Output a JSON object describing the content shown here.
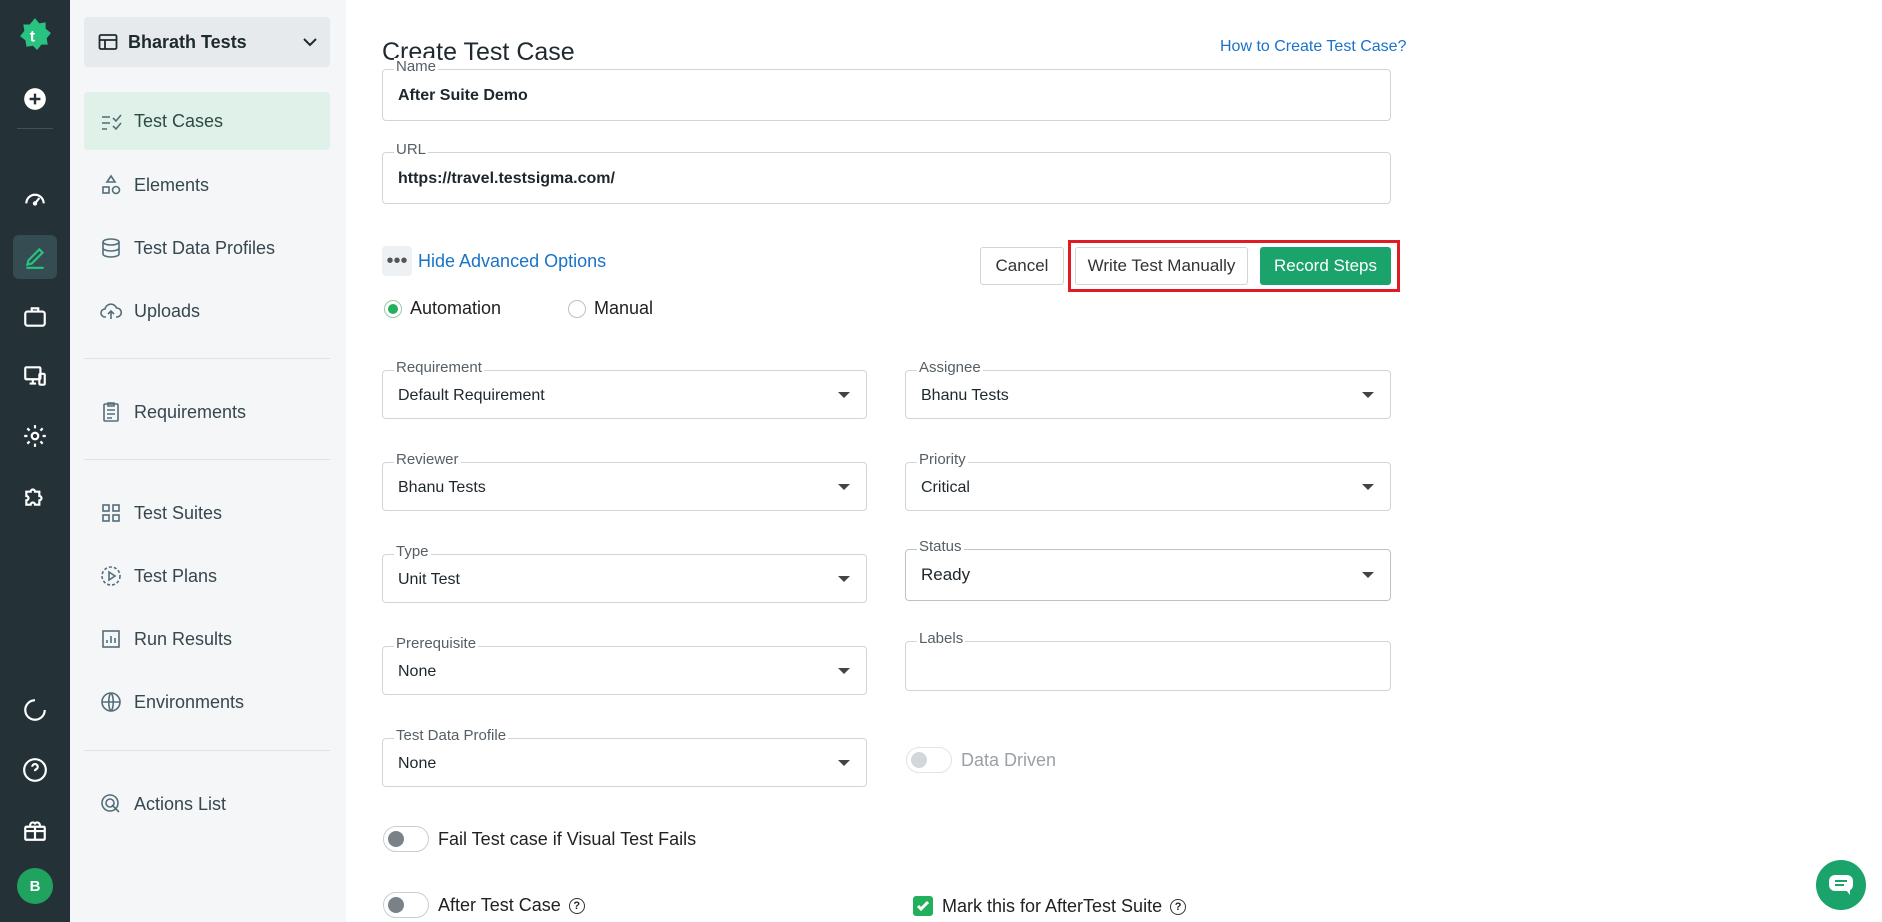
{
  "workspace": {
    "name": "Bharath Tests"
  },
  "sidebar": {
    "items": [
      {
        "label": "Test Cases",
        "icon": "checklist-icon"
      },
      {
        "label": "Elements",
        "icon": "shapes-icon"
      },
      {
        "label": "Test Data Profiles",
        "icon": "database-icon"
      },
      {
        "label": "Uploads",
        "icon": "cloud-upload-icon"
      },
      {
        "label": "Requirements",
        "icon": "clipboard-icon"
      },
      {
        "label": "Test Suites",
        "icon": "grid-icon"
      },
      {
        "label": "Test Plans",
        "icon": "play-circle-icon"
      },
      {
        "label": "Run Results",
        "icon": "bar-chart-icon"
      },
      {
        "label": "Environments",
        "icon": "globe-icon"
      },
      {
        "label": "Actions List",
        "icon": "target-icon"
      }
    ]
  },
  "rail": {
    "avatar_initial": "B"
  },
  "page": {
    "title": "Create Test Case",
    "help_link": "How to Create Test Case?"
  },
  "form": {
    "name": {
      "label": "Name",
      "value": "After Suite Demo"
    },
    "url": {
      "label": "URL",
      "value": "https://travel.testsigma.com/"
    },
    "advanced_toggle": "Hide Advanced Options",
    "buttons": {
      "cancel": "Cancel",
      "write": "Write Test Manually",
      "record": "Record Steps"
    },
    "mode": {
      "automation": "Automation",
      "manual": "Manual",
      "selected": "Automation"
    },
    "requirement": {
      "label": "Requirement",
      "value": "Default Requirement"
    },
    "assignee": {
      "label": "Assignee",
      "value": "Bhanu Tests"
    },
    "reviewer": {
      "label": "Reviewer",
      "value": "Bhanu Tests"
    },
    "priority": {
      "label": "Priority",
      "value": "Critical"
    },
    "type": {
      "label": "Type",
      "value": "Unit Test"
    },
    "status": {
      "label": "Status",
      "value": "Ready"
    },
    "prerequisite": {
      "label": "Prerequisite",
      "value": "None"
    },
    "labels": {
      "label": "Labels",
      "value": ""
    },
    "test_data_profile": {
      "label": "Test Data Profile",
      "value": "None"
    },
    "data_driven": "Data Driven",
    "visual_fail": "Fail Test case if Visual Test Fails",
    "after_test_case": "After Test Case",
    "after_suite": "Mark this for AfterTest Suite"
  },
  "colors": {
    "accent": "#1aa36a",
    "rail": "#243238",
    "highlight": "#e01b24",
    "link": "#1a73c9"
  }
}
